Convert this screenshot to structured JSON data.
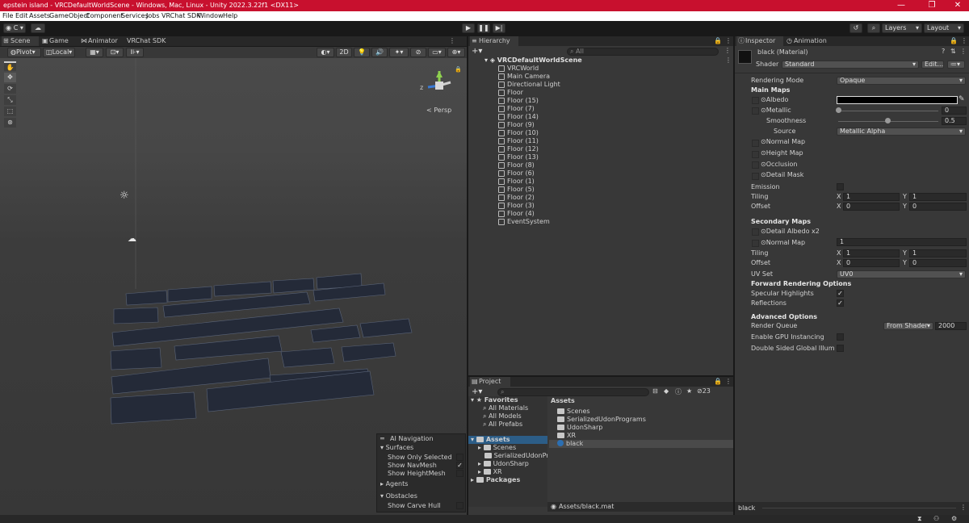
{
  "window": {
    "title": "epstein island - VRCDefaultWorldScene - Windows, Mac, Linux - Unity 2022.3.22f1 <DX11>",
    "min": "—",
    "max": "❐",
    "close": "✕"
  },
  "menu": [
    "File",
    "Edit",
    "Assets",
    "GameObject",
    "Component",
    "Services",
    "Jobs",
    "VRChat SDK",
    "Window",
    "Help"
  ],
  "toolbar": {
    "account": "C",
    "play": "▶",
    "pause": "❚❚",
    "step": "▶|",
    "layers": "Layers",
    "layout": "Layout"
  },
  "tabs": {
    "scene": "Scene",
    "game": "Game",
    "animator": "Animator",
    "vrchat": "VRChat SDK",
    "hierarchy": "Hierarchy",
    "project": "Project",
    "inspector": "Inspector",
    "animation": "Animation"
  },
  "scene_toolbar": {
    "pivot": "Pivot",
    "local": "Local",
    "mode2d": "2D",
    "persp": "< Persp"
  },
  "hierarchy": {
    "search_placeholder": "All",
    "root": "VRCDefaultWorldScene",
    "items": [
      "VRCWorld",
      "Main Camera",
      "Directional Light",
      "Floor",
      "Floor (15)",
      "Floor (7)",
      "Floor (14)",
      "Floor (9)",
      "Floor (10)",
      "Floor (11)",
      "Floor (12)",
      "Floor (13)",
      "Floor (8)",
      "Floor (6)",
      "Floor (1)",
      "Floor (5)",
      "Floor (2)",
      "Floor (3)",
      "Floor (4)",
      "EventSystem"
    ]
  },
  "project": {
    "favorites": "Favorites",
    "fav_items": [
      "All Materials",
      "All Models",
      "All Prefabs"
    ],
    "assets": "Assets",
    "tree_items": [
      "Scenes",
      "SerializedUdonProg",
      "UdonSharp",
      "XR"
    ],
    "packages": "Packages",
    "right_header": "Assets",
    "right_items": [
      "Scenes",
      "SerializedUdonPrograms",
      "UdonSharp",
      "XR",
      "black"
    ],
    "hidden_count": "23",
    "footer_path": "Assets/black.mat"
  },
  "ai_navigation": {
    "title": "AI Navigation",
    "surfaces": "Surfaces",
    "show_only_selected": "Show Only Selected",
    "show_navmesh": "Show NavMesh",
    "show_heightmesh": "Show HeightMesh",
    "agents": "Agents",
    "obstacles": "Obstacles",
    "show_carve_hull": "Show Carve Hull"
  },
  "inspector": {
    "material_name": "black (Material)",
    "shader_label": "Shader",
    "shader_value": "Standard",
    "edit": "Edit...",
    "rendering_mode": "Rendering Mode",
    "rendering_mode_value": "Opaque",
    "main_maps": "Main Maps",
    "albedo": "Albedo",
    "metallic": "Metallic",
    "metallic_value": "0",
    "smoothness": "Smoothness",
    "smoothness_value": "0.5",
    "source": "Source",
    "source_value": "Metallic Alpha",
    "normal_map": "Normal Map",
    "height_map": "Height Map",
    "occlusion": "Occlusion",
    "detail_mask": "Detail Mask",
    "emission": "Emission",
    "tiling": "Tiling",
    "offset": "Offset",
    "x": "X",
    "y": "Y",
    "tiling_x": "1",
    "tiling_y": "1",
    "offset_x": "0",
    "offset_y": "0",
    "secondary_maps": "Secondary Maps",
    "detail_albedo": "Detail Albedo x2",
    "normal_map2": "Normal Map",
    "normal_map2_value": "1",
    "tiling2_x": "1",
    "tiling2_y": "1",
    "offset2_x": "0",
    "offset2_y": "0",
    "uv_set": "UV Set",
    "uv_set_value": "UV0",
    "forward_options": "Forward Rendering Options",
    "specular": "Specular Highlights",
    "reflections": "Reflections",
    "advanced": "Advanced Options",
    "render_queue": "Render Queue",
    "render_queue_mode": "From Shader",
    "render_queue_value": "2000",
    "gpu_instancing": "Enable GPU Instancing",
    "double_sided": "Double Sided Global Illuminati",
    "footer_name": "black"
  },
  "colors": {
    "titlebar": "#c8102e",
    "panel": "#383838",
    "albedo": "#000000"
  }
}
